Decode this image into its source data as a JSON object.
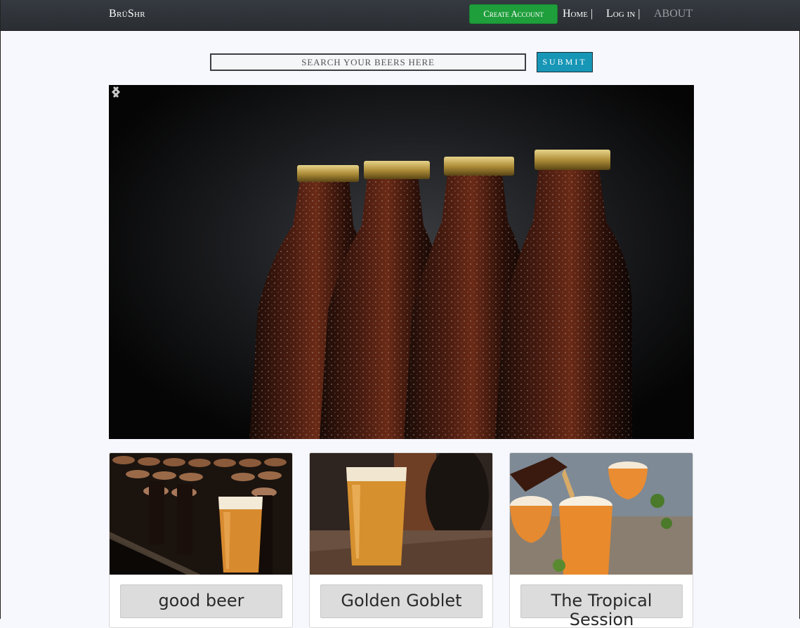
{
  "navbar": {
    "brand": "BrüShr",
    "create_account": "Create Account",
    "home": "Home |",
    "login": "Log in |",
    "about": "ABOUT"
  },
  "search": {
    "placeholder": "SEARCH YOUR BEERS HERE",
    "submit": "SUBMIT"
  },
  "carousel": {
    "prev_icon": "chevron-left-icon",
    "next_icon": "chevron-right-icon"
  },
  "cards": [
    {
      "name": "good beer"
    },
    {
      "name": "Golden Goblet"
    },
    {
      "name": "The Tropical Session"
    }
  ],
  "colors": {
    "navbar_bg": "#2f3338",
    "create_account_bg": "#1f9e3c",
    "submit_bg": "#1796b6"
  }
}
